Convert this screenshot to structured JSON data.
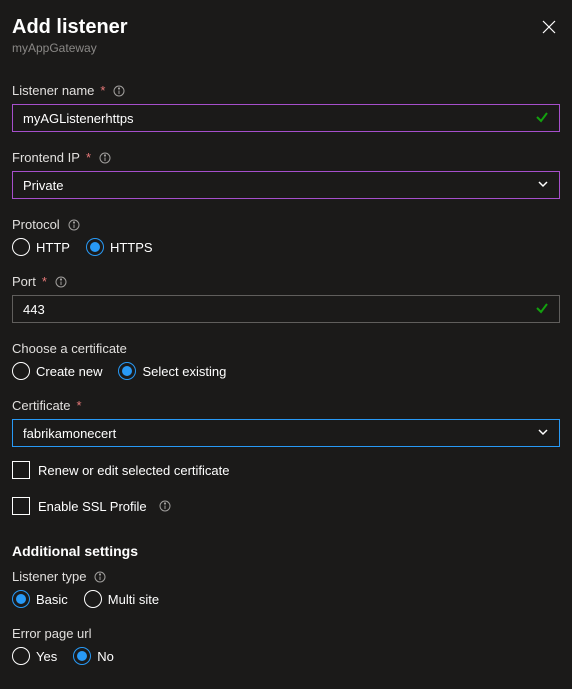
{
  "header": {
    "title": "Add listener",
    "subtitle": "myAppGateway"
  },
  "listenerName": {
    "label": "Listener name",
    "value": "myAGListenerhttps"
  },
  "frontendIP": {
    "label": "Frontend IP",
    "value": "Private"
  },
  "protocol": {
    "label": "Protocol",
    "options": {
      "http": "HTTP",
      "https": "HTTPS"
    }
  },
  "port": {
    "label": "Port",
    "value": "443"
  },
  "certificateChoice": {
    "label": "Choose a certificate",
    "options": {
      "create": "Create new",
      "existing": "Select existing"
    }
  },
  "certificate": {
    "label": "Certificate",
    "value": "fabrikamonecert"
  },
  "renewCert": {
    "label": "Renew or edit selected certificate"
  },
  "enableSSL": {
    "label": "Enable SSL Profile"
  },
  "additional": {
    "heading": "Additional settings"
  },
  "listenerType": {
    "label": "Listener type",
    "options": {
      "basic": "Basic",
      "multi": "Multi site"
    }
  },
  "errorPage": {
    "label": "Error page url",
    "options": {
      "yes": "Yes",
      "no": "No"
    }
  }
}
